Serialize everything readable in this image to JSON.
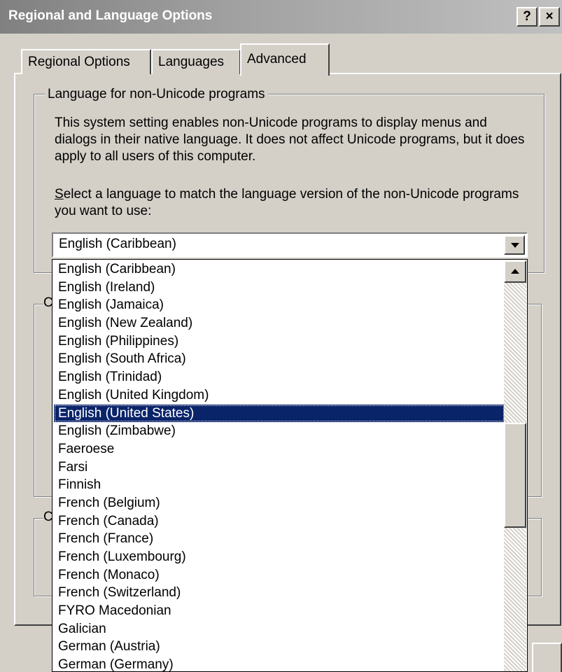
{
  "window": {
    "title": "Regional and Language Options",
    "help_label": "?",
    "close_label": "×"
  },
  "tabs": [
    {
      "label": "Regional Options",
      "active": false
    },
    {
      "label": "Languages",
      "active": false
    },
    {
      "label": "Advanced",
      "active": true
    }
  ],
  "language_group": {
    "legend": "Language for non-Unicode programs",
    "description": "This system setting enables non-Unicode programs to display menus and dialogs in their native language. It does not affect Unicode programs, but it does apply to all users of this computer.",
    "prompt_access_key": "S",
    "prompt_rest": "elect a language to match the language version of the non-Unicode programs you want to use:",
    "selected_value": "English (Caribbean)"
  },
  "dropdown": {
    "items": [
      "English (Caribbean)",
      "English (Ireland)",
      "English (Jamaica)",
      "English (New Zealand)",
      "English (Philippines)",
      "English (South Africa)",
      "English (Trinidad)",
      "English (United Kingdom)",
      "English (United States)",
      "English (Zimbabwe)",
      "Faeroese",
      "Farsi",
      "Finnish",
      "French (Belgium)",
      "French (Canada)",
      "French (France)",
      "French (Luxembourg)",
      "French (Monaco)",
      "French (Switzerland)",
      "FYRO Macedonian",
      "Galician",
      "German (Austria)",
      "German (Germany)"
    ],
    "highlighted": "English (United States)"
  },
  "hidden_groups": {
    "group2_stub": "C",
    "group3_stub": "C"
  },
  "colors": {
    "face": "#d4d0c8",
    "highlight": "#0a246a",
    "title_gradient_start": "#808080",
    "title_gradient_end": "#c0c0c0"
  }
}
